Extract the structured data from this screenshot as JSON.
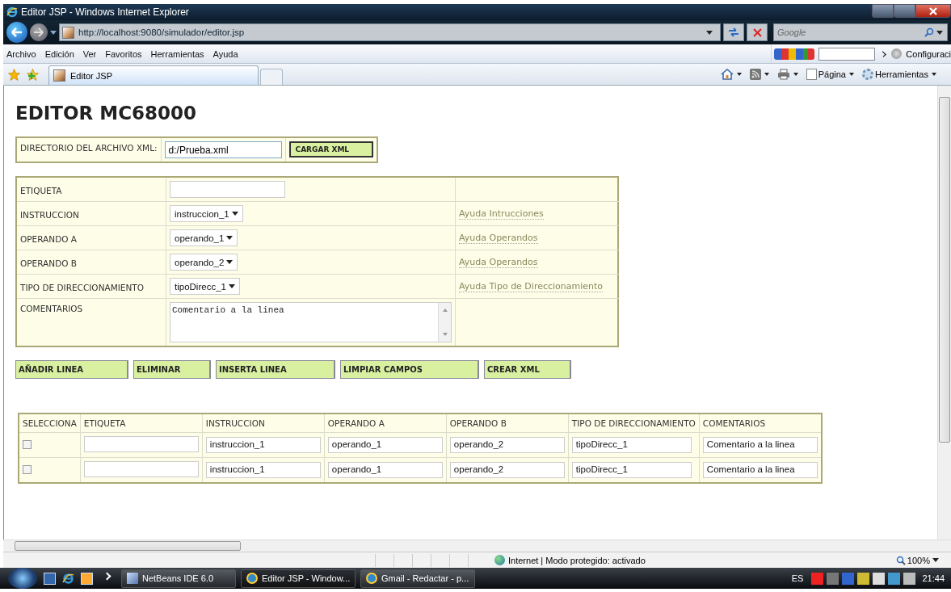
{
  "window": {
    "title": "Editor JSP - Windows Internet Explorer"
  },
  "address_bar": {
    "url": "http://localhost:9080/simulador/editor.jsp"
  },
  "search": {
    "placeholder": "Google"
  },
  "menu": [
    "Archivo",
    "Edición",
    "Ver",
    "Favoritos",
    "Herramientas",
    "Ayuda"
  ],
  "google_toolbar": {
    "settings": "Configuraci"
  },
  "tab": {
    "title": "Editor JSP"
  },
  "command_bar": [
    "Página",
    "Herramientas"
  ],
  "page": {
    "heading": "EDITOR MC68000",
    "xml_loader": {
      "label": "DIRECTORIO DEL ARCHIVO XML:",
      "value": "d:/Prueba.xml",
      "button": "CARGAR XML"
    },
    "form_rows": [
      {
        "label": "ETIQUETA",
        "kind": "text"
      },
      {
        "label": "INSTRUCCION",
        "kind": "select",
        "value": "instruccion_1",
        "help": "Ayuda Intrucciones"
      },
      {
        "label": "OPERANDO A",
        "kind": "select",
        "value": "operando_1",
        "help": "Ayuda Operandos"
      },
      {
        "label": "OPERANDO B",
        "kind": "select",
        "value": "operando_2",
        "help": "Ayuda Operandos"
      },
      {
        "label": "TIPO DE DIRECCIONAMIENTO",
        "kind": "select",
        "value": "tipoDirecc_1",
        "help": "Ayuda Tipo de Direccionamiento"
      },
      {
        "label": "COMENTARIOS",
        "kind": "textarea",
        "value": "Comentario a la linea"
      }
    ],
    "actions": [
      "AÑADIR LINEA",
      "ELIMINAR",
      "INSERTA LINEA",
      "LIMPIAR CAMPOS",
      "CREAR XML"
    ],
    "table": {
      "columns": [
        "SELECCIONA",
        "ETIQUETA",
        "INSTRUCCION",
        "OPERANDO A",
        "OPERANDO B",
        "TIPO DE DIRECCIONAMIENTO",
        "COMENTARIOS"
      ],
      "rows": [
        {
          "cells": [
            {
              "kind": "checkbox",
              "checked": false
            },
            {
              "kind": "input"
            },
            {
              "kind": "input",
              "value": "instruccion_1"
            },
            {
              "kind": "input",
              "value": "operando_1"
            },
            {
              "kind": "input",
              "value": "operando_2"
            },
            {
              "kind": "input",
              "value": "tipoDirecc_1"
            },
            {
              "kind": "input",
              "value": "Comentario a la linea"
            }
          ]
        },
        {
          "cells": [
            {
              "kind": "checkbox",
              "checked": false
            },
            {
              "kind": "input"
            },
            {
              "kind": "input",
              "value": "instruccion_1"
            },
            {
              "kind": "input",
              "value": "operando_1"
            },
            {
              "kind": "input",
              "value": "operando_2"
            },
            {
              "kind": "input",
              "value": "tipoDirecc_1"
            },
            {
              "kind": "input",
              "value": "Comentario a la linea"
            }
          ]
        }
      ]
    }
  },
  "status_bar": {
    "zone": "Internet | Modo protegido: activado",
    "zoom": "100%"
  },
  "taskbar": {
    "items": [
      {
        "label": "NetBeans IDE 6.0",
        "selected": false
      },
      {
        "label": "Editor JSP - Window...",
        "selected": true
      },
      {
        "label": "Gmail - Redactar - p...",
        "selected": false
      }
    ],
    "language": "ES",
    "clock": "21:44"
  }
}
